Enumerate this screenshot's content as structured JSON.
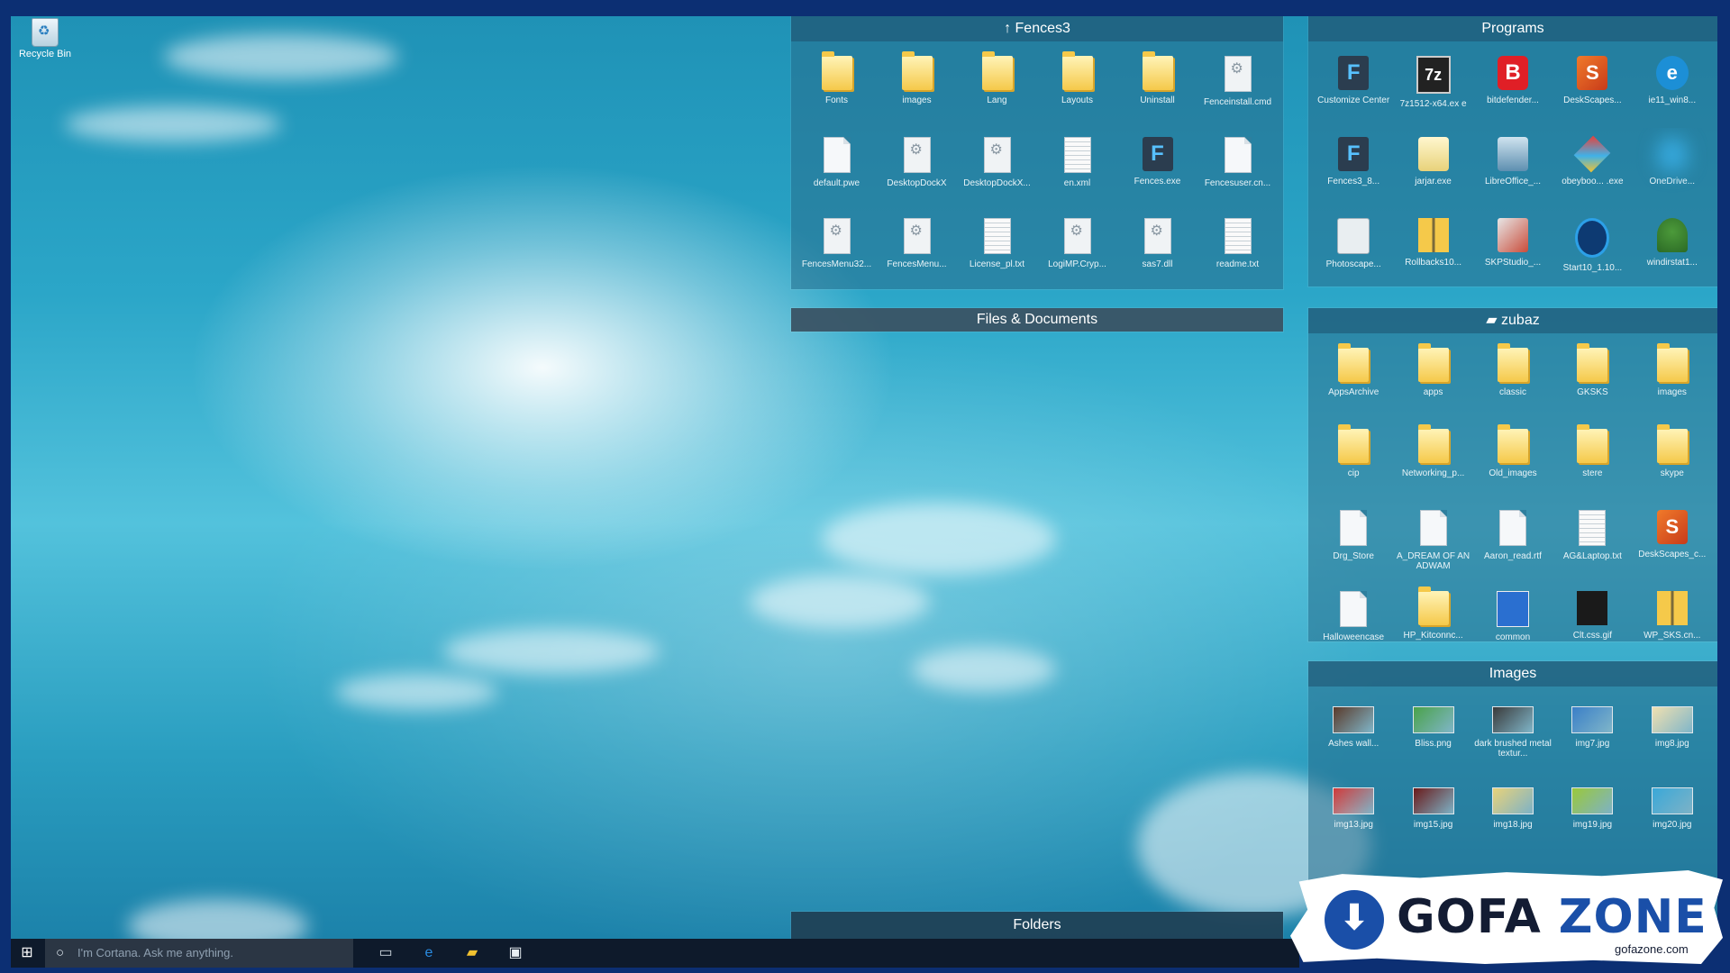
{
  "desktop": {
    "recycle_bin_label": "Recycle Bin"
  },
  "fences": [
    {
      "title": "Fences3",
      "title_icon": "pin-up-icon",
      "items": [
        {
          "label": "Fonts",
          "icon": "folder"
        },
        {
          "label": "images",
          "icon": "folder"
        },
        {
          "label": "Lang",
          "icon": "folder"
        },
        {
          "label": "Layouts",
          "icon": "folder"
        },
        {
          "label": "Uninstall",
          "icon": "folder"
        },
        {
          "label": "Fenceinstall.cmd",
          "icon": "gear"
        },
        {
          "label": "default.pwe",
          "icon": "page"
        },
        {
          "label": "DesktopDockX",
          "icon": "gear"
        },
        {
          "label": "DesktopDockX...",
          "icon": "gear"
        },
        {
          "label": "en.xml",
          "icon": "text"
        },
        {
          "label": "Fences.exe",
          "icon": "fences"
        },
        {
          "label": "Fencesuser.cn...",
          "icon": "page"
        },
        {
          "label": "FencesMenu32...",
          "icon": "gear"
        },
        {
          "label": "FencesMenu...",
          "icon": "gear"
        },
        {
          "label": "License_pl.txt",
          "icon": "text"
        },
        {
          "label": "LogiMP.Cryp...",
          "icon": "gear"
        },
        {
          "label": "sas7.dll",
          "icon": "gear"
        },
        {
          "label": "readme.txt",
          "icon": "text"
        }
      ]
    },
    {
      "title": "Programs",
      "items": [
        {
          "label": "Customize Center",
          "icon": "fences"
        },
        {
          "label": "7z1512-x64.ex e",
          "icon": "app7z"
        },
        {
          "label": "bitdefender...",
          "icon": "bdef"
        },
        {
          "label": "DeskScapes...",
          "icon": "scapes"
        },
        {
          "label": "ie11_win8...",
          "icon": "ie"
        },
        {
          "label": "Fences3_8...",
          "icon": "fences"
        },
        {
          "label": "jarjar.exe",
          "icon": "jar"
        },
        {
          "label": "LibreOffice_...",
          "icon": "office"
        },
        {
          "label": "obeyboo... .exe",
          "icon": "cube"
        },
        {
          "label": "OneDrive...",
          "icon": "cloud"
        },
        {
          "label": "Photoscape...",
          "icon": "photo"
        },
        {
          "label": "Rollbacks10...",
          "icon": "zip"
        },
        {
          "label": "SKPStudio_...",
          "icon": "skp"
        },
        {
          "label": "Start10_1.10...",
          "icon": "start"
        },
        {
          "label": "windirstat1...",
          "icon": "tree"
        }
      ]
    },
    {
      "title": "Files & Documents",
      "items": []
    },
    {
      "title": "zubaz",
      "title_icon": "folder-icon",
      "items": [
        {
          "label": "AppsArchive",
          "icon": "folder"
        },
        {
          "label": "apps",
          "icon": "folder"
        },
        {
          "label": "classic",
          "icon": "folder"
        },
        {
          "label": "GKSKS",
          "icon": "folder"
        },
        {
          "label": "images",
          "icon": "folder"
        },
        {
          "label": "cip",
          "icon": "folder"
        },
        {
          "label": "Networking_p...",
          "icon": "folder"
        },
        {
          "label": "Old_images",
          "icon": "folder"
        },
        {
          "label": "stere",
          "icon": "folder"
        },
        {
          "label": "skype",
          "icon": "folder"
        },
        {
          "label": "Drg_Store",
          "icon": "page"
        },
        {
          "label": "A_DREAM OF AN ADWAM",
          "icon": "page"
        },
        {
          "label": "Aaron_read.rtf",
          "icon": "page"
        },
        {
          "label": "AG&Laptop.txt",
          "icon": "text"
        },
        {
          "label": "DeskScapes_c...",
          "icon": "scapes"
        },
        {
          "label": "Halloweencase",
          "icon": "page"
        },
        {
          "label": "HP_Kitconnc...",
          "icon": "folder"
        },
        {
          "label": "common",
          "icon": "blue"
        },
        {
          "label": "Clt.css.gif",
          "icon": "redlogo"
        },
        {
          "label": "WP_SKS.cn...",
          "icon": "zip"
        }
      ]
    },
    {
      "title": "Images",
      "items": [
        {
          "label": "Ashes wall...",
          "icon": "img",
          "color": "#5a3a2a"
        },
        {
          "label": "Bliss.png",
          "icon": "img",
          "color": "#4aa24a"
        },
        {
          "label": "dark brushed metal textur...",
          "icon": "img",
          "color": "#3a3a3a"
        },
        {
          "label": "img7.jpg",
          "icon": "img",
          "color": "#3a7fc8"
        },
        {
          "label": "img8.jpg",
          "icon": "img",
          "color": "#f0e0b0"
        },
        {
          "label": "img13.jpg",
          "icon": "img",
          "color": "#d03a3a"
        },
        {
          "label": "img15.jpg",
          "icon": "img",
          "color": "#6a1a1a"
        },
        {
          "label": "img18.jpg",
          "icon": "img",
          "color": "#e8d27a"
        },
        {
          "label": "img19.jpg",
          "icon": "img",
          "color": "#9ac83a"
        },
        {
          "label": "img20.jpg",
          "icon": "img",
          "color": "#3aa8d8"
        }
      ]
    },
    {
      "title": "Folders",
      "items": []
    }
  ],
  "taskbar": {
    "search_placeholder": "I'm Cortana. Ask me anything.",
    "pinned": [
      {
        "name": "task-view-icon",
        "glyph": "▭",
        "color": "#cfd8e0"
      },
      {
        "name": "edge-icon",
        "glyph": "e",
        "color": "#2a8be0"
      },
      {
        "name": "file-explorer-icon",
        "glyph": "▰",
        "color": "#f2c230"
      },
      {
        "name": "store-icon",
        "glyph": "▣",
        "color": "#e8eef2"
      }
    ]
  },
  "watermark": {
    "brand_part1": "GOFA ",
    "brand_part2": "ZONE",
    "site": "gofazone.com"
  }
}
